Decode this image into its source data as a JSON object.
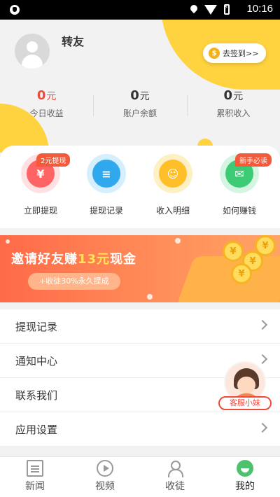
{
  "status_bar": {
    "time": "10:16"
  },
  "profile": {
    "username": "转友",
    "signin_label": "去签到>>"
  },
  "stats": [
    {
      "value": "0",
      "unit": "元",
      "label": "今日收益"
    },
    {
      "value": "0",
      "unit": "元",
      "label": "账户余额"
    },
    {
      "value": "0",
      "unit": "元",
      "label": "累积收入"
    }
  ],
  "quick_actions": [
    {
      "label": "立即提现",
      "icon": "yen-icon",
      "tag": "2元提现"
    },
    {
      "label": "提现记录",
      "icon": "document-icon"
    },
    {
      "label": "收入明细",
      "icon": "user-card-icon"
    },
    {
      "label": "如何赚钱",
      "icon": "money-envelope-icon",
      "tag": "新手必读"
    }
  ],
  "banner": {
    "title_prefix": "邀请好友赚",
    "title_highlight": "13元",
    "title_suffix": "现金",
    "subtitle": "+收徒30%永久提成"
  },
  "menu": [
    {
      "label": "提现记录"
    },
    {
      "label": "通知中心"
    },
    {
      "label": "联系我们"
    },
    {
      "label": "应用设置"
    }
  ],
  "customer_service": {
    "label": "客服小妹"
  },
  "tabbar": [
    {
      "label": "新闻",
      "icon": "news-icon"
    },
    {
      "label": "视频",
      "icon": "video-play-icon"
    },
    {
      "label": "收徒",
      "icon": "users-icon"
    },
    {
      "label": "我的",
      "icon": "profile-icon",
      "active": true
    }
  ],
  "colors": {
    "accent_yellow": "#ffd23f",
    "accent_red": "#f04a3a",
    "active_green": "#4cc26e"
  }
}
